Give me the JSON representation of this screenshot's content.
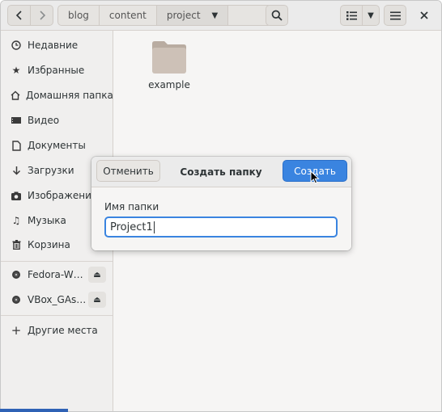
{
  "toolbar": {
    "breadcrumbs": [
      "blog",
      "content",
      "project"
    ],
    "icons": {
      "back": "chevron-left-icon",
      "forward": "chevron-right-icon",
      "path_dropdown": "triangle-down-icon",
      "search": "search-icon",
      "view_list": "list-view-icon",
      "view_menu": "triangle-down-icon",
      "main_menu": "hamburger-icon",
      "close": "close-icon"
    }
  },
  "sidebar": {
    "items": [
      {
        "label": "Недавние",
        "icon": "clock-icon"
      },
      {
        "label": "Избранные",
        "icon": "star-icon"
      },
      {
        "label": "Домашняя папка",
        "icon": "home-icon"
      },
      {
        "label": "Видео",
        "icon": "video-icon"
      },
      {
        "label": "Документы",
        "icon": "document-icon"
      },
      {
        "label": "Загрузки",
        "icon": "download-icon"
      },
      {
        "label": "Изображения",
        "icon": "camera-icon"
      },
      {
        "label": "Музыка",
        "icon": "music-icon"
      },
      {
        "label": "Корзина",
        "icon": "trash-icon"
      }
    ],
    "devices": [
      {
        "label": "Fedora-W…",
        "icon": "disk-icon",
        "action_icon": "eject-icon"
      },
      {
        "label": "VBox_GAs…",
        "icon": "disk-icon",
        "action_icon": "eject-icon"
      }
    ],
    "other_locations": {
      "label": "Другие места",
      "icon": "plus-icon"
    }
  },
  "content": {
    "items": [
      {
        "name": "example",
        "icon": "folder-icon"
      }
    ]
  },
  "dialog": {
    "cancel_label": "Отменить",
    "title": "Создать папку",
    "create_label": "Создать",
    "field_label": "Имя папки",
    "field_value": "Project1"
  },
  "colors": {
    "accent": "#3a84e0",
    "headerbar": "#ebebeb",
    "sidebar": "#f0efee",
    "folder": "#cdc1b7"
  }
}
